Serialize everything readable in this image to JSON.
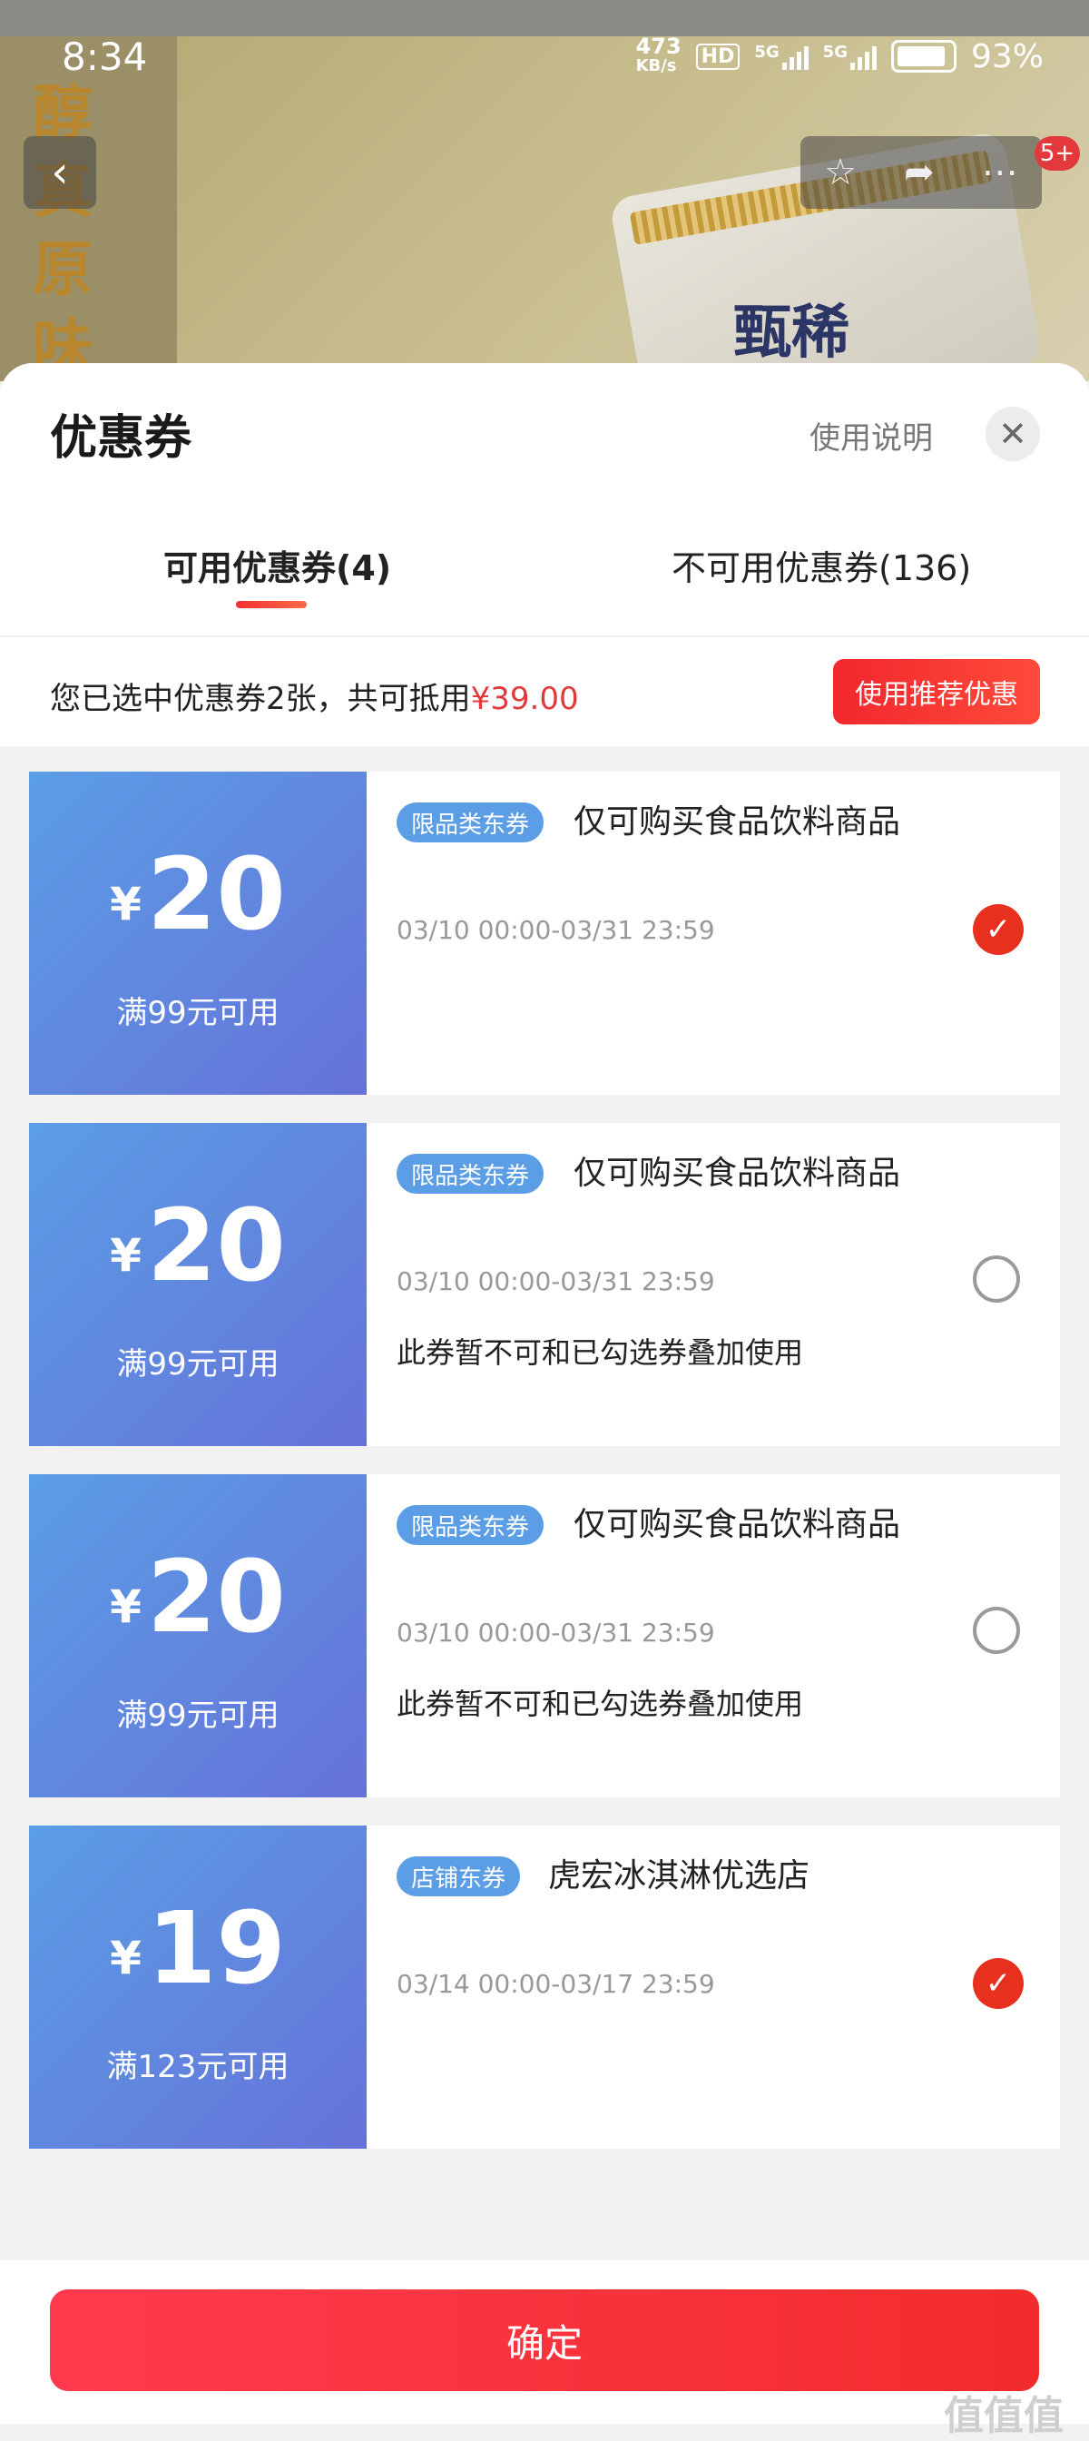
{
  "status_bar": {
    "time": "8:34",
    "net_speed_top": "473",
    "net_speed_unit": "KB/s",
    "hd": "HD",
    "sig1": "5G",
    "sig2": "5G",
    "battery": "93%"
  },
  "background": {
    "vertical_text": "醇 真 原 味",
    "brand": "甄稀",
    "badge": "5+"
  },
  "sheet": {
    "title": "优惠券",
    "help_label": "使用说明",
    "tabs": [
      {
        "label": "可用优惠券(4)"
      },
      {
        "label": "不可用优惠券(136)"
      }
    ],
    "summary_prefix": "您已选中优惠券2张，共可抵用",
    "summary_amount": "¥39.00",
    "recommend_label": "使用推荐优惠"
  },
  "coupons": [
    {
      "currency": "¥",
      "amount": "20",
      "condition": "满99元可用",
      "tag": "限品类东券",
      "scope": "仅可购买食品饮料商品",
      "date": "03/10 00:00-03/31 23:59",
      "warning": "",
      "selected": true
    },
    {
      "currency": "¥",
      "amount": "20",
      "condition": "满99元可用",
      "tag": "限品类东券",
      "scope": "仅可购买食品饮料商品",
      "date": "03/10 00:00-03/31 23:59",
      "warning": "此券暂不可和已勾选券叠加使用",
      "selected": false
    },
    {
      "currency": "¥",
      "amount": "20",
      "condition": "满99元可用",
      "tag": "限品类东券",
      "scope": "仅可购买食品饮料商品",
      "date": "03/10 00:00-03/31 23:59",
      "warning": "此券暂不可和已勾选券叠加使用",
      "selected": false
    },
    {
      "currency": "¥",
      "amount": "19",
      "condition": "满123元可用",
      "tag": "店铺东券",
      "scope": "虎宏冰淇淋优选店",
      "date": "03/14 00:00-03/17 23:59",
      "warning": "",
      "selected": true
    }
  ],
  "footer": {
    "confirm_label": "确定"
  },
  "watermark": "值值值",
  "colors": {
    "accent_red": "#e4393c",
    "coupon_blue": "#5b9ee6",
    "coupon_purple": "#6672d8"
  },
  "icons": {
    "back": "chevron-left-icon",
    "favorite": "star-icon",
    "share": "share-icon",
    "more": "more-icon",
    "close": "close-icon",
    "checked": "checkmark-icon"
  }
}
